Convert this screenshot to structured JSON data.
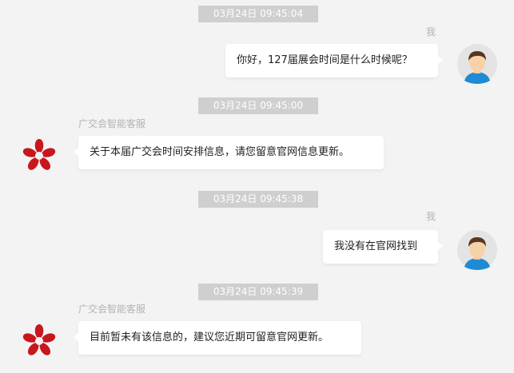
{
  "messages": [
    {
      "time": "03月24日 09:45:04",
      "sender": "我",
      "text": "你好，127届展会时间是什么时候呢？"
    },
    {
      "time": "03月24日 09:45:00",
      "sender": "广交会智能客服",
      "text": "关于本届广交会时间安排信息，请您留意官网信息更新。"
    },
    {
      "time": "03月24日 09:45:38",
      "sender": "我",
      "text": "我没有在官网找到"
    },
    {
      "time": "03月24日 09:45:39",
      "sender": "广交会智能客服",
      "text": "目前暂未有该信息的，建议您近期可留意官网更新。"
    }
  ],
  "icons": {
    "user_avatar": "user-avatar-icon",
    "bot_avatar": "canton-fair-logo-icon"
  },
  "colors": {
    "timestamp_bg": "#cfcfcf",
    "logo_red": "#c8161d",
    "avatar_shirt": "#1e8bd2"
  }
}
